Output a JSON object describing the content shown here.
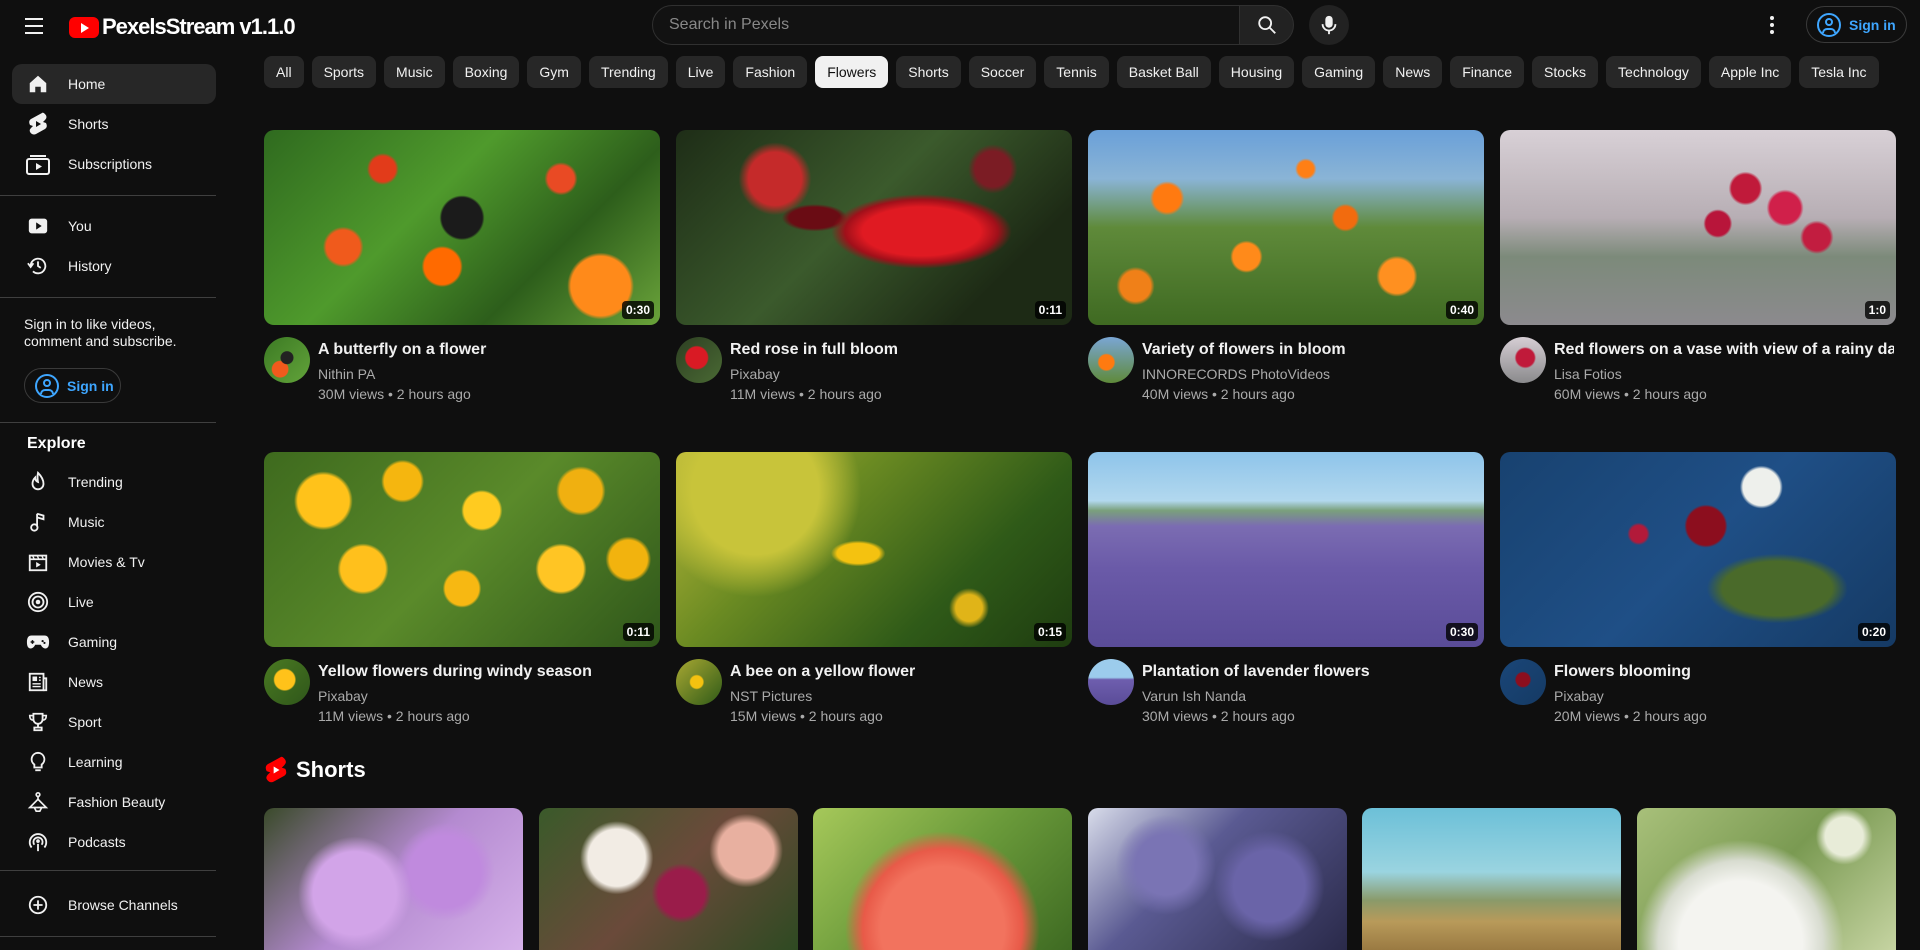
{
  "app": {
    "title": "PexelsStream v1.1.0",
    "accent": "#ff0000",
    "link_color": "#3ea6ff"
  },
  "topbar": {
    "search_placeholder": "Search in Pexels",
    "signin_label": "Sign in"
  },
  "sidebar": {
    "main": [
      {
        "label": "Home",
        "icon": "home-icon"
      },
      {
        "label": "Shorts",
        "icon": "shorts-icon"
      },
      {
        "label": "Subscriptions",
        "icon": "subscriptions-icon"
      }
    ],
    "you": [
      {
        "label": "You",
        "icon": "you-icon"
      },
      {
        "label": "History",
        "icon": "history-icon"
      }
    ],
    "signin_message": "Sign in to like videos, comment and subscribe.",
    "signin_label": "Sign in",
    "explore_title": "Explore",
    "explore": [
      {
        "label": "Trending",
        "icon": "trending-icon"
      },
      {
        "label": "Music",
        "icon": "music-icon"
      },
      {
        "label": "Movies & Tv",
        "icon": "movies-icon"
      },
      {
        "label": "Live",
        "icon": "live-icon"
      },
      {
        "label": "Gaming",
        "icon": "gaming-icon"
      },
      {
        "label": "News",
        "icon": "news-icon"
      },
      {
        "label": "Sport",
        "icon": "sport-icon"
      },
      {
        "label": "Learning",
        "icon": "learning-icon"
      },
      {
        "label": "Fashion Beauty",
        "icon": "fashion-icon"
      },
      {
        "label": "Podcasts",
        "icon": "podcasts-icon"
      }
    ],
    "browse_channels": "Browse Channels"
  },
  "chips": [
    "All",
    "Sports",
    "Music",
    "Boxing",
    "Gym",
    "Trending",
    "Live",
    "Fashion",
    "Flowers",
    "Shorts",
    "Soccer",
    "Tennis",
    "Basket Ball",
    "Housing",
    "Gaming",
    "News",
    "Finance",
    "Stocks",
    "Technology",
    "Apple Inc",
    "Tesla Inc"
  ],
  "active_chip": "Flowers",
  "videos": [
    {
      "title": "A butterfly on a flower",
      "channel": "Nithin PA",
      "stats": "30M views • 2 hours ago",
      "duration": "0:30"
    },
    {
      "title": "Red rose in full bloom",
      "channel": "Pixabay",
      "stats": "11M views • 2 hours ago",
      "duration": "0:11"
    },
    {
      "title": "Variety of flowers in bloom",
      "channel": "INNORECORDS PhotoVideos",
      "stats": "40M views • 2 hours ago",
      "duration": "0:40"
    },
    {
      "title": "Red flowers on a vase with view of a rainy day",
      "channel": "Lisa Fotios",
      "stats": "60M views • 2 hours ago",
      "duration": "1:0"
    },
    {
      "title": "Yellow flowers during windy season",
      "channel": "Pixabay",
      "stats": "11M views • 2 hours ago",
      "duration": "0:11"
    },
    {
      "title": "A bee on a yellow flower",
      "channel": "NST Pictures",
      "stats": "15M views • 2 hours ago",
      "duration": "0:15"
    },
    {
      "title": "Plantation of lavender flowers",
      "channel": "Varun Ish Nanda",
      "stats": "30M views • 2 hours ago",
      "duration": "0:30"
    },
    {
      "title": "Flowers blooming",
      "channel": "Pixabay",
      "stats": "20M views • 2 hours ago",
      "duration": "0:20"
    }
  ],
  "shorts": {
    "title": "Shorts"
  }
}
